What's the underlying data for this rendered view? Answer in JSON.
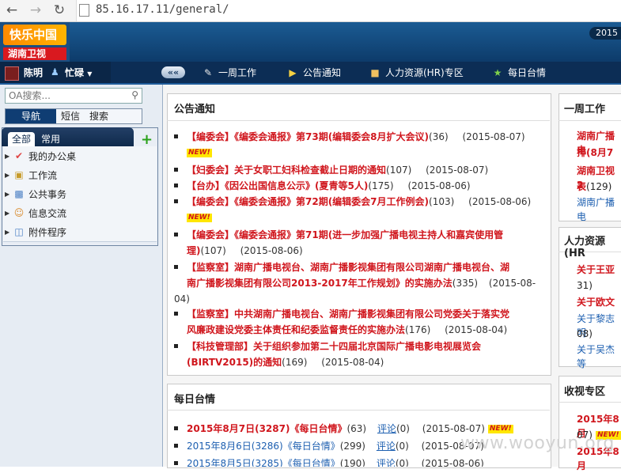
{
  "browser": {
    "url": "85.16.17.11/general/",
    "back_icon": "back-arrow-icon",
    "forward_icon": "forward-arrow-icon",
    "reload_icon": "reload-icon"
  },
  "header": {
    "logo_top": "快乐中国",
    "logo_bottom": "湖南卫视",
    "date_badge": "2015"
  },
  "menubar": {
    "user_name": "陈明",
    "status": "忙碌",
    "items": [
      {
        "label": "一周工作",
        "icon": "edit-icon"
      },
      {
        "label": "公告通知",
        "icon": "megaphone-icon"
      },
      {
        "label": "人力资源(HR)专区",
        "icon": "folder-users-icon"
      },
      {
        "label": "每日台情",
        "icon": "star-icon"
      }
    ]
  },
  "sidebar": {
    "search_placeholder": "OA搜索...",
    "tabs": [
      "导航",
      "短信",
      "搜索"
    ],
    "subtabs": [
      "全部",
      "常用"
    ],
    "items": [
      {
        "label": "我的办公桌",
        "icon": "desk-icon"
      },
      {
        "label": "工作流",
        "icon": "workflow-icon"
      },
      {
        "label": "公共事务",
        "icon": "public-affairs-icon"
      },
      {
        "label": "信息交流",
        "icon": "users-icon"
      },
      {
        "label": "附件程序",
        "icon": "attachment-icon"
      }
    ]
  },
  "notices": {
    "title": "公告通知",
    "items": [
      {
        "line1": "【编委会】《编委会通报》第73期(编辑委会8月扩大会议)",
        "count": "(36)",
        "date": "(2015-08-07)",
        "new": "NEW!"
      },
      {
        "line1": "【妇委会】关于女职工妇科检查截止日期的通知",
        "count": "(107)",
        "date": "(2015-08-07)"
      },
      {
        "line1": "【台办】《因公出国信息公示》(夏青等5人)",
        "count": "(175)",
        "date": "(2015-08-06)"
      },
      {
        "line1": "【编委会】《编委会通报》第72期(编辑委会7月工作例会)",
        "count": "(103)",
        "date": "(2015-08-06)",
        "new": "NEW!"
      },
      {
        "line1": "【编委会】《编委会通报》第71期(进一步加强广播电视主持人和嘉宾使用管",
        "line2": "理)",
        "count": "(107)",
        "date": "(2015-08-06)"
      },
      {
        "line1": "【监察室】湖南广播电视台、湖南广播影视集团有限公司湖南广播电视台、湖",
        "line2": "南广播影视集团有限公司2013-2017年工作规划》的实施办法",
        "count": "(335)",
        "date": "(2015-08-",
        "date2": "04)"
      },
      {
        "line1": "【监察室】中共湖南广播电视台、湖南广播影视集团有限公司党委关于落实党",
        "line2": "风廉政建设党委主体责任和纪委监督责任的实施办法",
        "count": "(176)",
        "date": "(2015-08-04)"
      },
      {
        "line1": "【科技管理部】关于组织参加第二十四届北京国际广播电影电视展览会",
        "line2": "(BIRTV2015)的通知",
        "count": "(169)",
        "date": "(2015-08-04)"
      }
    ]
  },
  "daily": {
    "title": "每日台情",
    "items": [
      {
        "text": "2015年8月7日(3287)《每日台情》",
        "count": "(63)",
        "comment": "评论",
        "ccount": "(0)",
        "date": "(2015-08-07)",
        "new": "NEW!"
      },
      {
        "text": "2015年8月6日(3286)《每日台情》",
        "count": "(299)",
        "comment": "评论",
        "ccount": "(0)",
        "date": "(2015-08-07)"
      },
      {
        "text": "2015年8月5日(3285)《每日台情》",
        "count": "(190)",
        "comment": "评论",
        "ccount": "(0)",
        "date": "(2015-08-06)"
      }
    ]
  },
  "week_work": {
    "title": "一周工作",
    "items": [
      "湖南广播电",
      "排(8月7",
      "湖南卫视2",
      "表",
      "湖南广播电"
    ],
    "count": "(129)"
  },
  "hr": {
    "title": "人力资源(HR",
    "items": [
      "关于王亚",
      "31)",
      "关于欧文",
      "关于黎志明",
      "08)",
      "关于吴杰等"
    ]
  },
  "ratings": {
    "title": "收视专区",
    "items": [
      "2015年8月",
      "07)",
      "2015年8月"
    ],
    "new": "NEW!"
  },
  "watermark": "www.wooyun.org"
}
